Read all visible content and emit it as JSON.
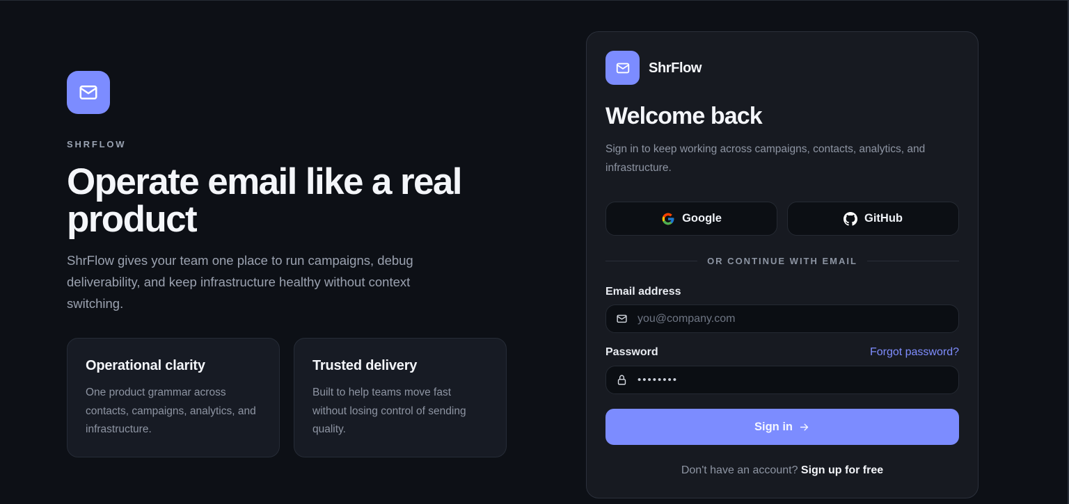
{
  "hero": {
    "eyebrow": "SHRFLOW",
    "headline": "Operate email like a real product",
    "description": "ShrFlow gives your team one place to run campaigns, debug deliverability, and keep infrastructure healthy without context switching.",
    "logo_icon": "mail-icon",
    "features": [
      {
        "title": "Operational clarity",
        "text": "One product grammar across contacts, campaigns, analytics, and infrastructure."
      },
      {
        "title": "Trusted delivery",
        "text": "Built to help teams move fast without losing control of sending quality."
      }
    ]
  },
  "auth": {
    "brand_name": "ShrFlow",
    "brand_icon": "mail-icon",
    "title": "Welcome back",
    "subtitle": "Sign in to keep working across campaigns, contacts, analytics, and infrastructure.",
    "oauth": {
      "google_label": "Google",
      "github_label": "GitHub"
    },
    "divider_text": "OR CONTINUE WITH EMAIL",
    "email": {
      "label": "Email address",
      "placeholder": "you@company.com",
      "value": ""
    },
    "password": {
      "label": "Password",
      "value": "••••••••",
      "forgot_label": "Forgot password?"
    },
    "submit_label": "Sign in",
    "signup_prompt": "Don't have an account?",
    "signup_link": "Sign up for free"
  },
  "colors": {
    "background": "#0d1016",
    "card": "#171a21",
    "accent": "#7c8cff",
    "muted_text": "#8e95a3"
  }
}
